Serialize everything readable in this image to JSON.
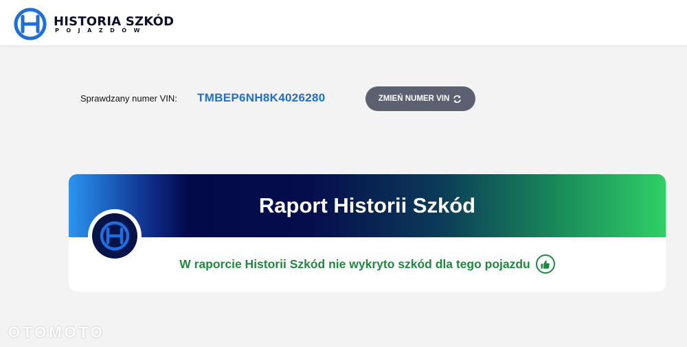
{
  "header": {
    "brand_name": "HISTORIA SZKÓD",
    "brand_sub": "POJAZDÓW",
    "logo_icon": "hs-logo-icon"
  },
  "vin": {
    "label": "Sprawdzany numer VIN:",
    "value": "TMBEP6NH8K4026280",
    "change_button": "ZMIEŃ NUMER VIN",
    "change_icon": "refresh-icon"
  },
  "report": {
    "title": "Raport Historii Szkód",
    "result": "W raporcie Historii Szkód nie wykryto szkód dla tego pojazdu",
    "result_icon": "thumbs-up-icon"
  },
  "watermark": "OTOMOTO",
  "colors": {
    "accent_blue": "#1d6fd6",
    "success_green": "#1e8a3e",
    "button_gray": "#5b6170",
    "brand_navy": "#071448"
  }
}
